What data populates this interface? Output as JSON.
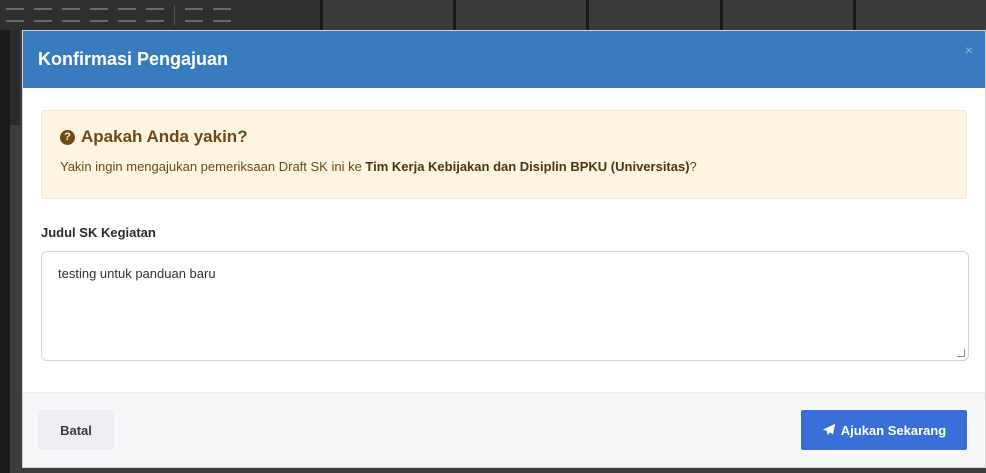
{
  "modal": {
    "title": "Konfirmasi Pengajuan",
    "close_icon": "close-icon",
    "close_glyph": "×"
  },
  "alert": {
    "icon": "question-circle-icon",
    "icon_glyph": "?",
    "title": "Apakah Anda yakin?",
    "text_before": "Yakin ingin mengajukan pemeriksaan Draft SK ini ke ",
    "text_bold": "Tim Kerja Kebijakan dan Disiplin BPKU (Universitas)",
    "text_after": "?"
  },
  "form": {
    "label": "Judul SK Kegiatan",
    "value": "testing untuk panduan baru"
  },
  "footer": {
    "cancel_label": "Batal",
    "submit_label": "Ajukan Sekarang",
    "submit_icon": "paper-plane-icon"
  },
  "colors": {
    "header_bg": "#3a7bbf",
    "alert_bg": "#fdf4e2",
    "submit_bg": "#3a6fd8"
  }
}
